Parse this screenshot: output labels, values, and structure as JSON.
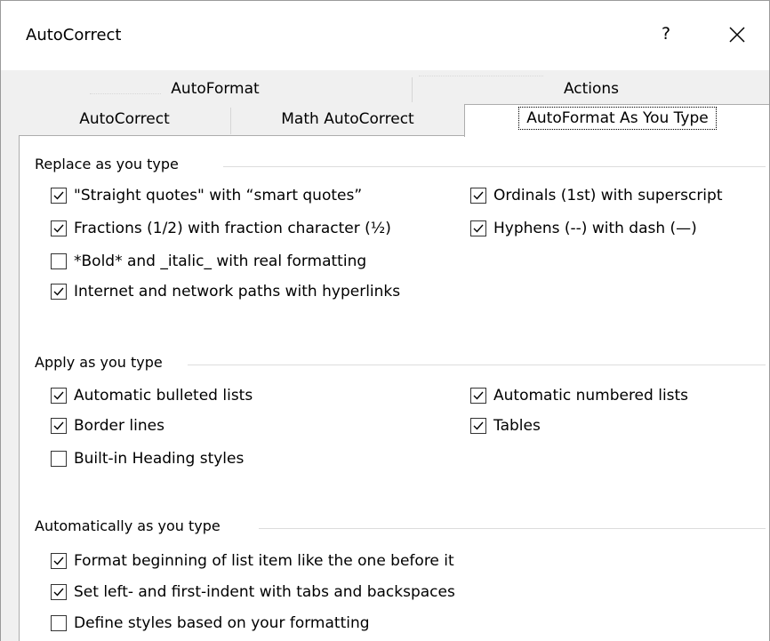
{
  "window": {
    "title": "AutoCorrect",
    "help_label": "?"
  },
  "tabs": {
    "row1": [
      {
        "label": "AutoFormat"
      },
      {
        "label": "Actions"
      }
    ],
    "row2": [
      {
        "label": "AutoCorrect"
      },
      {
        "label": "Math AutoCorrect"
      },
      {
        "label": "AutoFormat As You Type",
        "selected": true
      }
    ]
  },
  "groups": {
    "replace": {
      "label": "Replace as you type",
      "options": [
        {
          "label": "\"Straight quotes\" with “smart quotes”",
          "checked": true
        },
        {
          "label": "Fractions (1/2) with fraction character (½)",
          "checked": true
        },
        {
          "label": "*Bold* and _italic_ with real formatting",
          "checked": false
        },
        {
          "label": "Internet and network paths with hyperlinks",
          "checked": true
        },
        {
          "label": "Ordinals (1st) with superscript",
          "checked": true
        },
        {
          "label": "Hyphens (--) with dash (—)",
          "checked": true
        }
      ]
    },
    "apply": {
      "label": "Apply as you type",
      "options": [
        {
          "label": "Automatic bulleted lists",
          "checked": true
        },
        {
          "label": "Border lines",
          "checked": true
        },
        {
          "label": "Built-in Heading styles",
          "checked": false
        },
        {
          "label": "Automatic numbered lists",
          "checked": true
        },
        {
          "label": "Tables",
          "checked": true
        }
      ]
    },
    "automatic": {
      "label": "Automatically as you type",
      "options": [
        {
          "label": "Format beginning of list item like the one before it",
          "checked": true
        },
        {
          "label": "Set left- and first-indent with tabs and backspaces",
          "checked": true
        },
        {
          "label": "Define styles based on your formatting",
          "checked": false
        }
      ]
    }
  },
  "icons": {
    "close": "close-icon",
    "check": "check-icon"
  }
}
